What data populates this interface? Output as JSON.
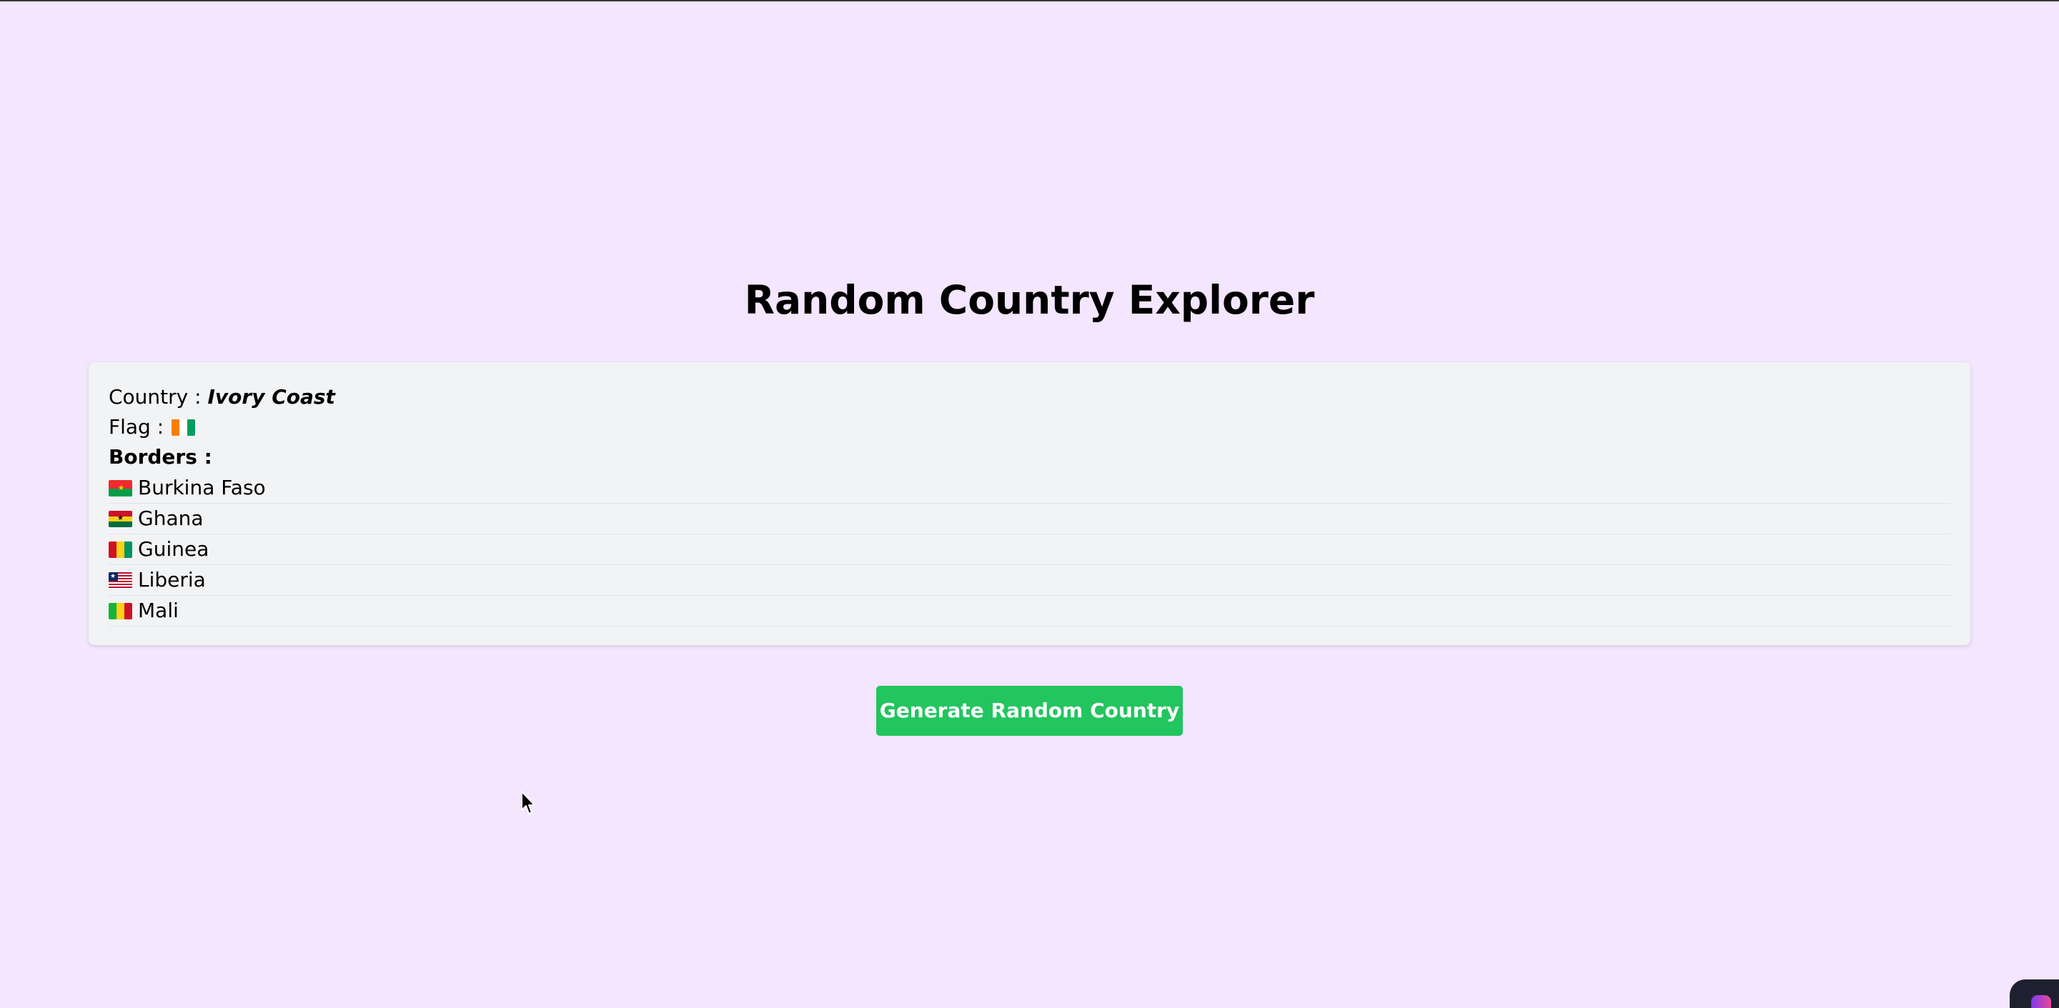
{
  "app": {
    "title": "Random Country Explorer"
  },
  "country": {
    "label": "Country :",
    "name": "Ivory Coast",
    "flag_label": "Flag :",
    "flag_icon": "ivory-coast-flag"
  },
  "borders": {
    "label": "Borders :",
    "items": [
      {
        "name": "Burkina Faso",
        "flag_icon": "burkina-faso-flag"
      },
      {
        "name": "Ghana",
        "flag_icon": "ghana-flag"
      },
      {
        "name": "Guinea",
        "flag_icon": "guinea-flag"
      },
      {
        "name": "Liberia",
        "flag_icon": "liberia-flag"
      },
      {
        "name": "Mali",
        "flag_icon": "mali-flag"
      }
    ]
  },
  "actions": {
    "generate_label": "Generate Random Country"
  },
  "colors": {
    "background": "#f3e6fe",
    "card": "#f2f3f5",
    "button": "#22c55e"
  }
}
